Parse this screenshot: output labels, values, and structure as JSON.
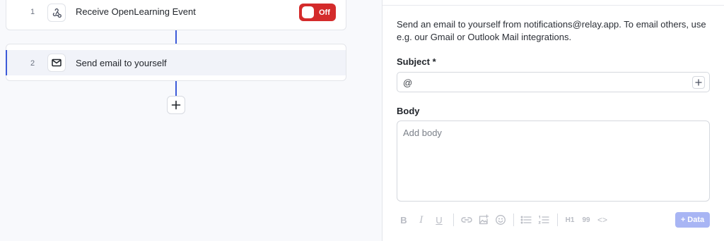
{
  "workflow": {
    "steps": [
      {
        "number": "1",
        "title": "Receive OpenLearning Event",
        "icon": "webhook-icon",
        "toggle_label": "Off"
      },
      {
        "number": "2",
        "title": "Send email to yourself",
        "icon": "mail-icon"
      }
    ],
    "add_step_icon": "plus-icon"
  },
  "panel": {
    "description": "Send an email to yourself from notifications@relay.app. To email others, use e.g. our Gmail or Outlook Mail integrations.",
    "subject_label": "Subject *",
    "subject_value": "@",
    "body_label": "Body",
    "body_placeholder": "Add body",
    "toolbar": {
      "bold": "B",
      "italic": "I",
      "underline": "U",
      "h1": "H1",
      "quote": "99",
      "code": "<>",
      "data_button": "+ Data"
    }
  },
  "colors": {
    "accent": "#3d5bd9",
    "toggle_off": "#d42b2b",
    "data_button": "#a8b5f4"
  }
}
